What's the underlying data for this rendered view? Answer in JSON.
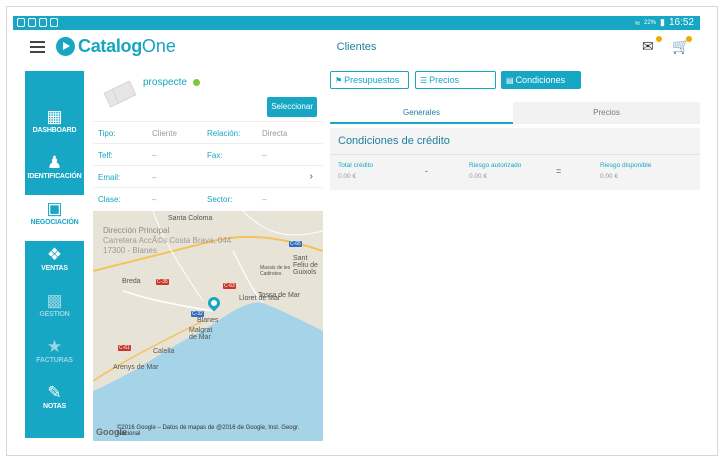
{
  "status_bar": {
    "battery": "22%",
    "time": "16:52"
  },
  "app_bar": {
    "brand_a": "Catalog",
    "brand_b": "One",
    "title": "Clientes"
  },
  "sidebar": {
    "items": [
      {
        "label": "DASHBOARD",
        "icon": "bar-chart-icon"
      },
      {
        "label": "IDENTIFICACIÓN",
        "icon": "person-icon"
      },
      {
        "label": "NEGOCIACIÓN",
        "icon": "briefcase-icon"
      },
      {
        "label": "VENTAS",
        "icon": "handshake-icon"
      },
      {
        "label": "GESTION",
        "icon": "building-icon"
      },
      {
        "label": "FACTURAS",
        "icon": "star-icon"
      },
      {
        "label": "NOTAS",
        "icon": "notes-icon"
      }
    ]
  },
  "client": {
    "name": "prospecte",
    "select_label": "Seleccionar",
    "fields": {
      "tipo_label": "Tipo:",
      "tipo_value": "Cliente",
      "relacion_label": "Relación:",
      "relacion_value": "Directa",
      "telf_label": "Telf:",
      "telf_value": "–",
      "fax_label": "Fax:",
      "fax_value": "–",
      "email_label": "Email:",
      "email_value": "–",
      "clase_label": "Clase:",
      "clase_value": "–",
      "sector_label": "Sector:",
      "sector_value": "–"
    }
  },
  "map": {
    "address_title": "Dirección Principal",
    "address_line1": "Carretera AccÃ©s Costa Brava, 044",
    "address_line2": "17300 - Blanes",
    "google_label": "Google",
    "copyright": "©2016 Google – Datos de mapas de @2016 de Google, Inst. Geogr. Nacional",
    "places": [
      "Santa Coloma",
      "Lloret de Mar",
      "Tossa de Mar",
      "Blanes",
      "Malgrat de Mar",
      "Calella",
      "Arenys de Mar",
      "Breda",
      "Sant Feliu de Guixols",
      "Massis de les Cadiretes"
    ],
    "roads": [
      "C-65",
      "C-35",
      "C-63",
      "C-32",
      "C-61"
    ]
  },
  "tabs": [
    {
      "label": "Presupuestos",
      "icon": "tag-icon"
    },
    {
      "label": "Precios",
      "icon": "money-icon"
    },
    {
      "label": "Condiciones",
      "icon": "document-icon"
    }
  ],
  "subtabs": [
    "Generales",
    "Precios"
  ],
  "credit": {
    "title": "Condiciones de crédito",
    "total_label": "Total crédito",
    "total_value": "0.00 €",
    "minus": "-",
    "riesgo_aut_label": "Riesgo autorizado",
    "riesgo_aut_value": "0.00 €",
    "equals": "=",
    "riesgo_disp_label": "Riesgo disponible",
    "riesgo_disp_value": "0.00 €"
  }
}
